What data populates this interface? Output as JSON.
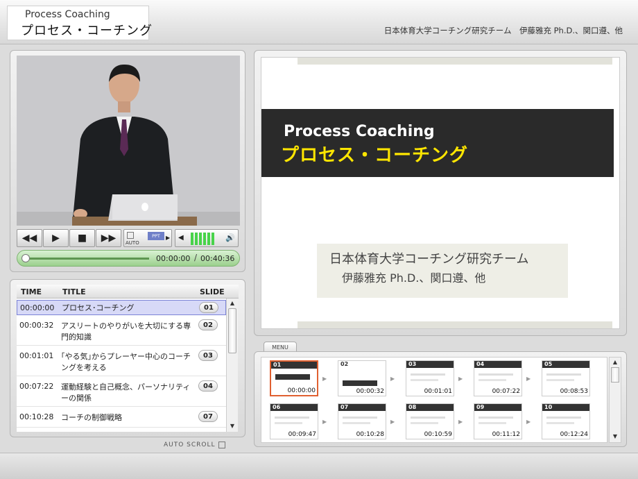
{
  "header": {
    "title_en": "Process Coaching",
    "title_ja": "プロセス・コーチング",
    "credit": "日本体育大学コーチング研究チーム　伊藤雅充 Ph.D.、関口遵、他"
  },
  "controls": {
    "auto_label": "AUTO",
    "ppt_label": "PPT",
    "current_time": "00:00:00",
    "separator": "/",
    "total_time": "00:40:36",
    "progress": 0
  },
  "list": {
    "headers": {
      "time": "TIME",
      "title": "TITLE",
      "slide": "SLIDE"
    },
    "rows": [
      {
        "time": "00:00:00",
        "title": "プロセス･コーチング",
        "slide": "01"
      },
      {
        "time": "00:00:32",
        "title": "アスリートのやりがいを大切にする専門的知識",
        "slide": "02"
      },
      {
        "time": "00:01:01",
        "title": "｢やる気｣からプレーヤー中心のコーチングを考える",
        "slide": "03"
      },
      {
        "time": "00:07:22",
        "title": "運動経験と自己概念、パーソナリティーの関係",
        "slide": "04"
      },
      {
        "time": "00:10:28",
        "title": "コーチの制御戦略",
        "slide": "07"
      }
    ],
    "auto_scroll": "AUTO SCROLL"
  },
  "slide": {
    "title_en": "Process Coaching",
    "title_ja": "プロセス・コーチング",
    "credit_line1": "日本体育大学コーチング研究チーム",
    "credit_line2": "伊藤雅充 Ph.D.、関口遵、他"
  },
  "menu": {
    "tab_label": "MENU",
    "thumbnails": [
      {
        "num": "01",
        "time": "00:00:00"
      },
      {
        "num": "02",
        "time": "00:00:32"
      },
      {
        "num": "03",
        "time": "00:01:01"
      },
      {
        "num": "04",
        "time": "00:07:22"
      },
      {
        "num": "05",
        "time": "00:08:53"
      },
      {
        "num": "06",
        "time": "00:09:47"
      },
      {
        "num": "07",
        "time": "00:10:28"
      },
      {
        "num": "08",
        "time": "00:10:59"
      },
      {
        "num": "09",
        "time": "00:11:12"
      },
      {
        "num": "10",
        "time": "00:12:24"
      }
    ]
  },
  "colors": {
    "accent_selected_row": "#d7d9f7",
    "volume": "#48d34a",
    "slide_yellow": "#ffe600",
    "thumb_selected": "#e06030"
  }
}
